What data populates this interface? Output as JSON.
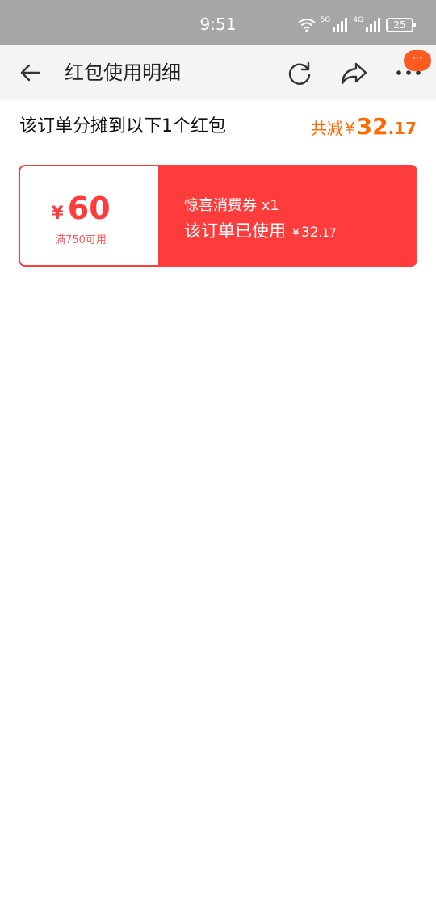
{
  "status_bar": {
    "time": "9:51",
    "network_5g": "5G",
    "network_4g": "4G",
    "battery": "25"
  },
  "nav": {
    "title": "红包使用明细",
    "badge": "···"
  },
  "summary": {
    "text": "该订单分摊到以下1个红包",
    "total_label": "共减",
    "currency": "¥",
    "total_int": "32",
    "total_dec": ".17"
  },
  "coupon": {
    "currency": "¥",
    "amount": "60",
    "condition": "满750可用",
    "name": "惊喜消费券 x1",
    "used_label": "该订单已使用",
    "used_currency": "¥",
    "used_int": "32",
    "used_dec": ".17"
  },
  "colors": {
    "accent_orange": "#ff6a00",
    "coupon_red": "#ff3c3c",
    "badge_orange": "#ff5a1f"
  }
}
